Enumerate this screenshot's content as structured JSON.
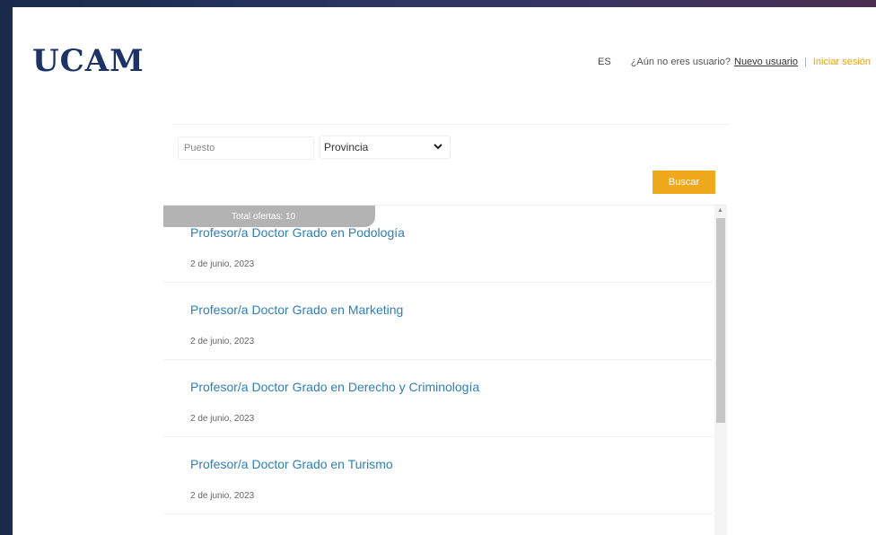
{
  "header": {
    "logo": "UCAM",
    "lang": "ES",
    "question": "¿Aún no eres usuario?",
    "new_user": "Nuevo usuario",
    "separator": "|",
    "login": "Iniciar sesión"
  },
  "search": {
    "puesto_placeholder": "Puesto",
    "provincia_selected": "Provincia",
    "button_label": "Buscar"
  },
  "results": {
    "total_label": "Total ofertas: 10",
    "items": [
      {
        "title": "Profesor/a Doctor Grado en Podología",
        "date": "2 de junio, 2023"
      },
      {
        "title": "Profesor/a Doctor Grado en Marketing",
        "date": "2 de junio, 2023"
      },
      {
        "title": "Profesor/a Doctor Grado en Derecho y Criminología",
        "date": "2 de junio, 2023"
      },
      {
        "title": "Profesor/a Doctor Grado en Turismo",
        "date": "2 de junio, 2023"
      }
    ]
  },
  "colors": {
    "brand_navy": "#1d3366",
    "accent_orange": "#f0a81c",
    "link_blue": "#2f7fb6"
  },
  "icons": {
    "select_arrow": "chevron-down-icon",
    "scroll_up": "scroll-up-arrow-icon"
  }
}
